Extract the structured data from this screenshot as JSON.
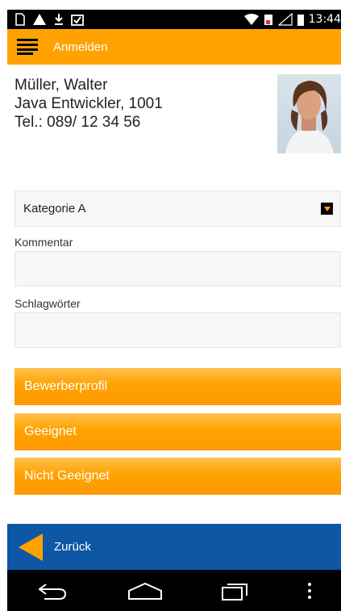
{
  "status_bar": {
    "time": "13:44",
    "left_icons": [
      "sim-icon",
      "notification-icon",
      "download-icon",
      "clipboard-icon"
    ],
    "right_icons": [
      "wifi-icon",
      "battery-saver-icon",
      "signal-icon",
      "battery-icon"
    ]
  },
  "action_bar": {
    "menu_icon": "hamburger-icon",
    "title": "Anmelden"
  },
  "profile": {
    "name": "Müller, Walter",
    "role": "Java Entwickler, 1001",
    "phone": "Tel.: 089/ 12 34 56"
  },
  "form": {
    "category_value": "Kategorie A",
    "comment_label": "Kommentar",
    "comment_value": "",
    "keywords_label": "Schlagwörter",
    "keywords_value": ""
  },
  "buttons": {
    "profile": "Bewerberprofil",
    "suitable": "Geeignet",
    "not_suitable": "Nicht Geeignet"
  },
  "footer": {
    "back_label": "Zurück"
  },
  "colors": {
    "accent": "#ffa200",
    "back_bar": "#0d57a4"
  }
}
